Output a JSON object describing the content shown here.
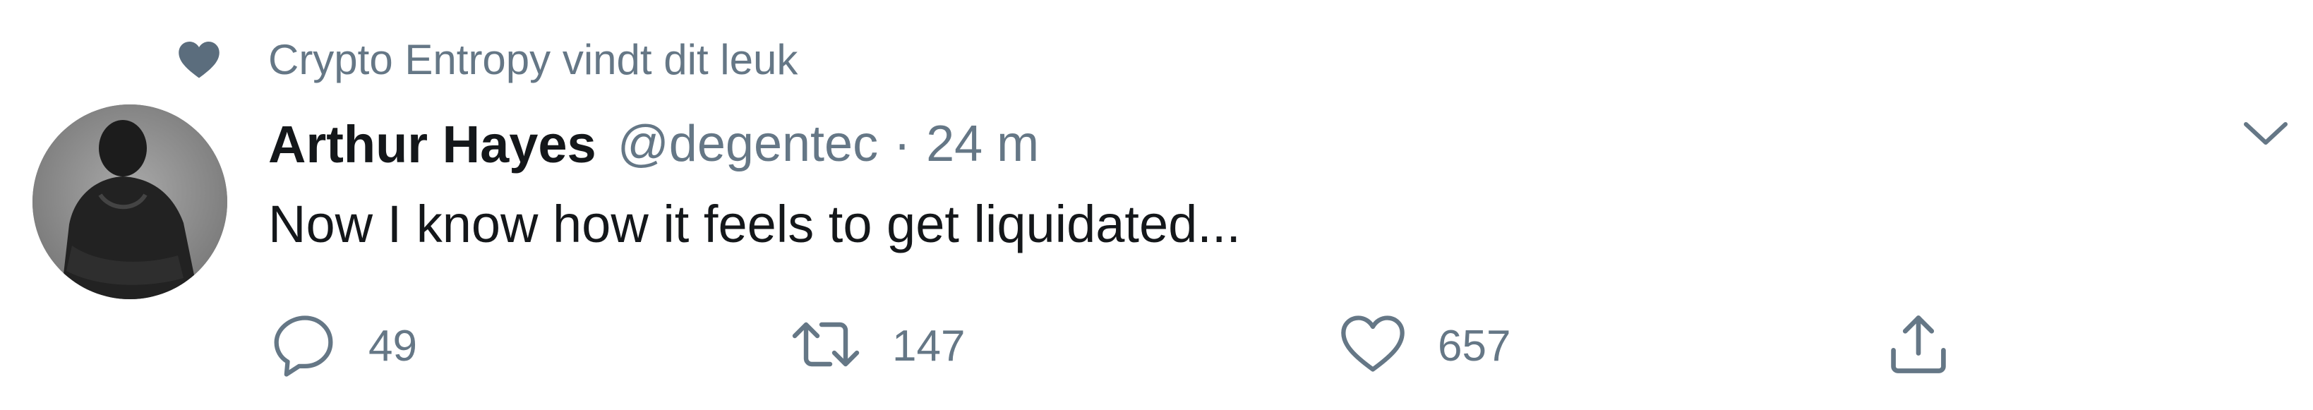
{
  "social_context": {
    "icon": "heart-icon",
    "text": "Crypto Entropy vindt dit leuk"
  },
  "author": {
    "name": "Arthur Hayes",
    "handle": "@degentec",
    "separator": "·",
    "timestamp": "24 m"
  },
  "tweet": {
    "text": "Now I know how it feels to get liquidated..."
  },
  "actions": {
    "reply": {
      "icon": "reply-icon",
      "count": "49"
    },
    "retweet": {
      "icon": "retweet-icon",
      "count": "147"
    },
    "like": {
      "icon": "like-icon",
      "count": "657"
    },
    "share": {
      "icon": "share-icon"
    }
  },
  "colors": {
    "text_primary": "#14171a",
    "text_secondary": "#657786",
    "icon_social": "#657786"
  }
}
